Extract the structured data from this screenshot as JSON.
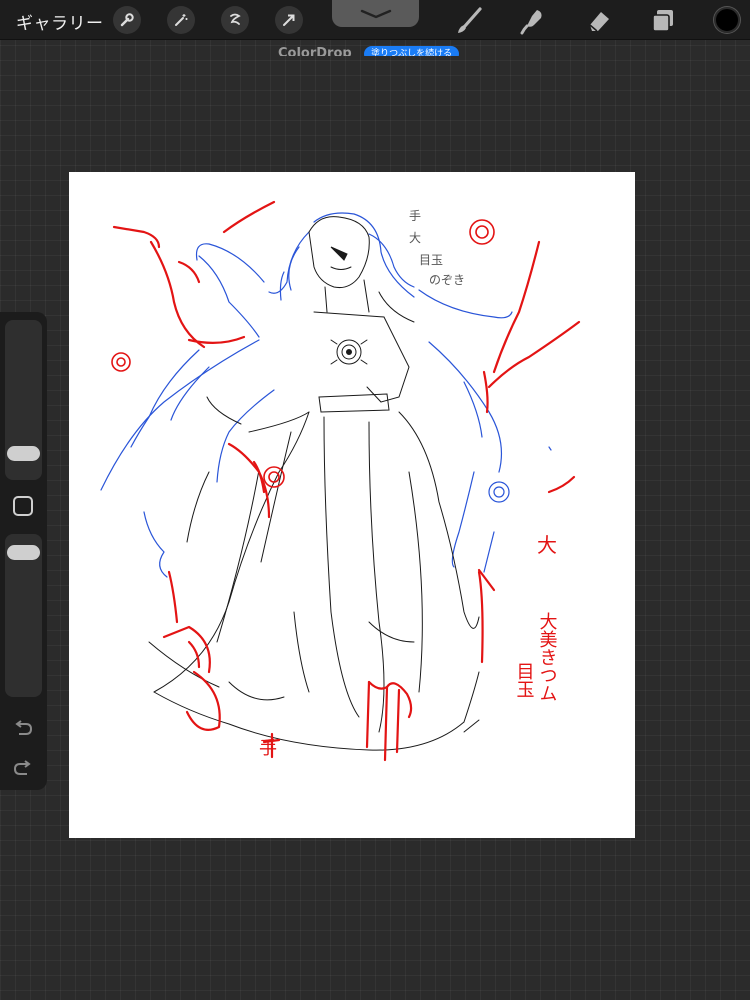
{
  "topbar": {
    "gallery_label": "ギャラリー",
    "left_tools": [
      "wrench-icon",
      "magic-wand-icon",
      "selection-icon",
      "transform-arrow-icon"
    ],
    "right_tools": [
      "brush-icon",
      "smudge-icon",
      "eraser-icon",
      "layers-icon"
    ],
    "current_color": "#000000"
  },
  "hint": {
    "title": "ColorDrop",
    "badge": "塗りつぶしを続ける"
  },
  "canvas": {
    "labels": {
      "note1": "手",
      "note2": "大",
      "note3": "目玉",
      "note4": "のぞき",
      "bottom_char": "手",
      "vertical_title_1": "大",
      "vertical_title_2": "大美きつム",
      "vertical_title_3": "目玉"
    },
    "stroke_colors": {
      "red": "#e31414",
      "blue": "#2a55d8",
      "black": "#1a1a1a"
    }
  },
  "accent": "#1a7cf5"
}
